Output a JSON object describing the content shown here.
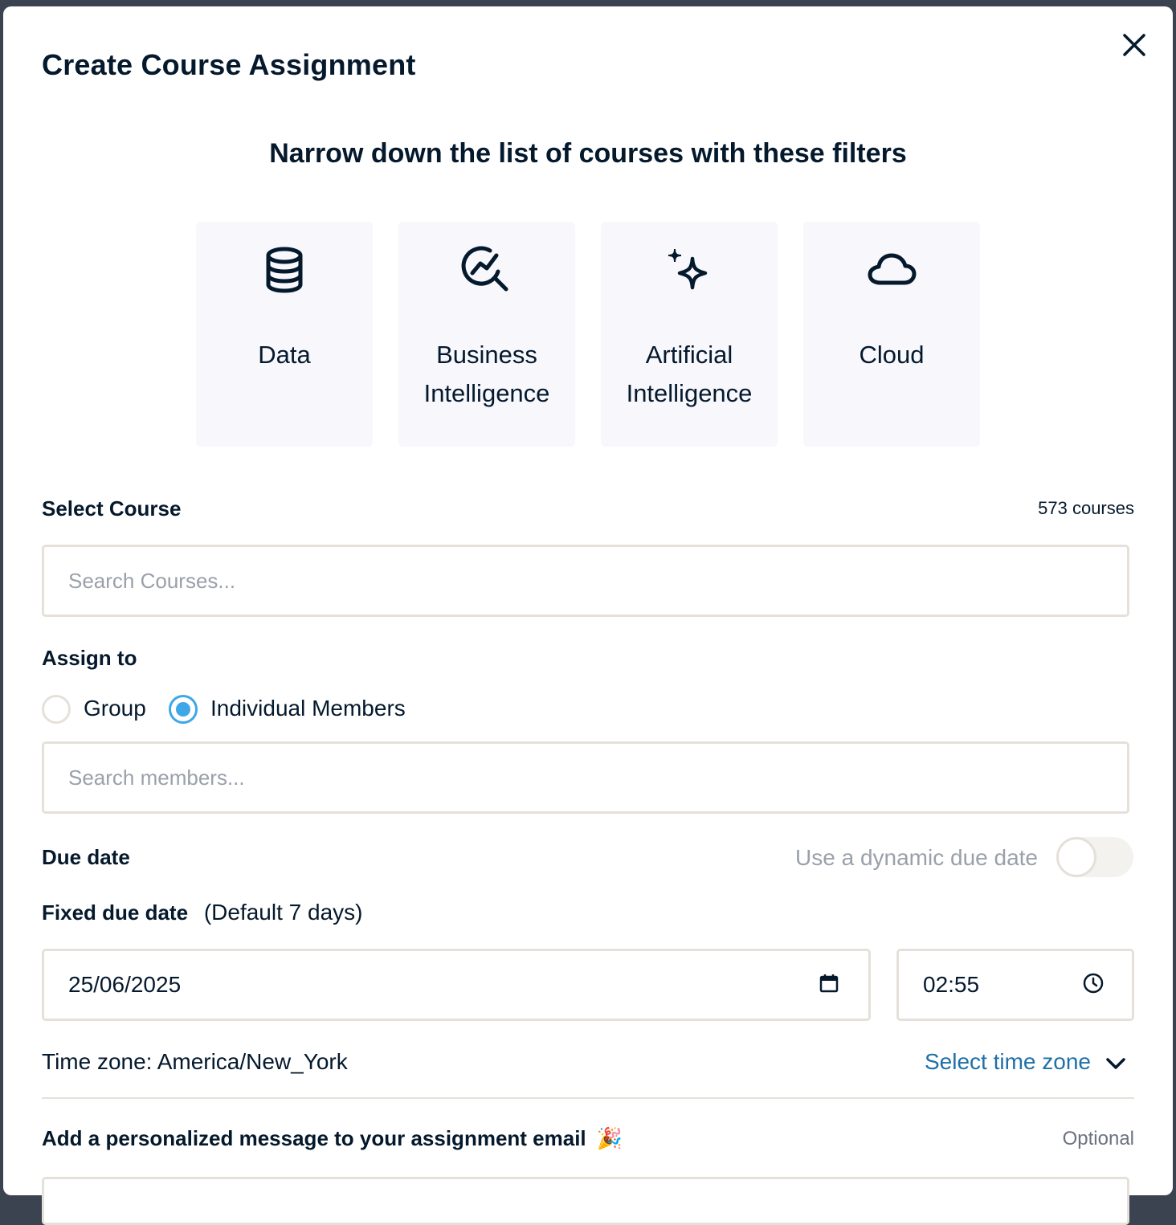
{
  "modal": {
    "title": "Create Course Assignment",
    "close_icon": "close-icon"
  },
  "filters": {
    "heading": "Narrow down the list of courses with these filters",
    "cards": [
      {
        "icon": "database-icon",
        "line1": "Data",
        "line2": ""
      },
      {
        "icon": "analytics-search-icon",
        "line1": "Business",
        "line2": "Intelligence"
      },
      {
        "icon": "sparkles-icon",
        "line1": "Artificial",
        "line2": "Intelligence"
      },
      {
        "icon": "cloud-icon",
        "line1": "Cloud",
        "line2": ""
      }
    ]
  },
  "course": {
    "label": "Select Course",
    "count": "573 courses",
    "placeholder": "Search Courses..."
  },
  "assign": {
    "label": "Assign to",
    "options": [
      "Group",
      "Individual Members"
    ],
    "selected": "Individual Members",
    "placeholder": "Search members..."
  },
  "due": {
    "label": "Due date",
    "dynamic_label": "Use a dynamic due date",
    "dynamic_enabled": false,
    "fixed_label": "Fixed due date",
    "fixed_hint": "(Default 7 days)",
    "date_value": "25/06/2025",
    "time_value": "02:55",
    "timezone_text": "Time zone: America/New_York",
    "timezone_link": "Select time zone"
  },
  "message": {
    "label": "Add a personalized message to your assignment email",
    "emoji": "🎉",
    "optional": "Optional"
  },
  "colors": {
    "text": "#05192d",
    "accent": "#3ea7e8",
    "link": "#1f6fa8",
    "border": "#e5e1da",
    "card_bg": "#f7f7fc"
  }
}
